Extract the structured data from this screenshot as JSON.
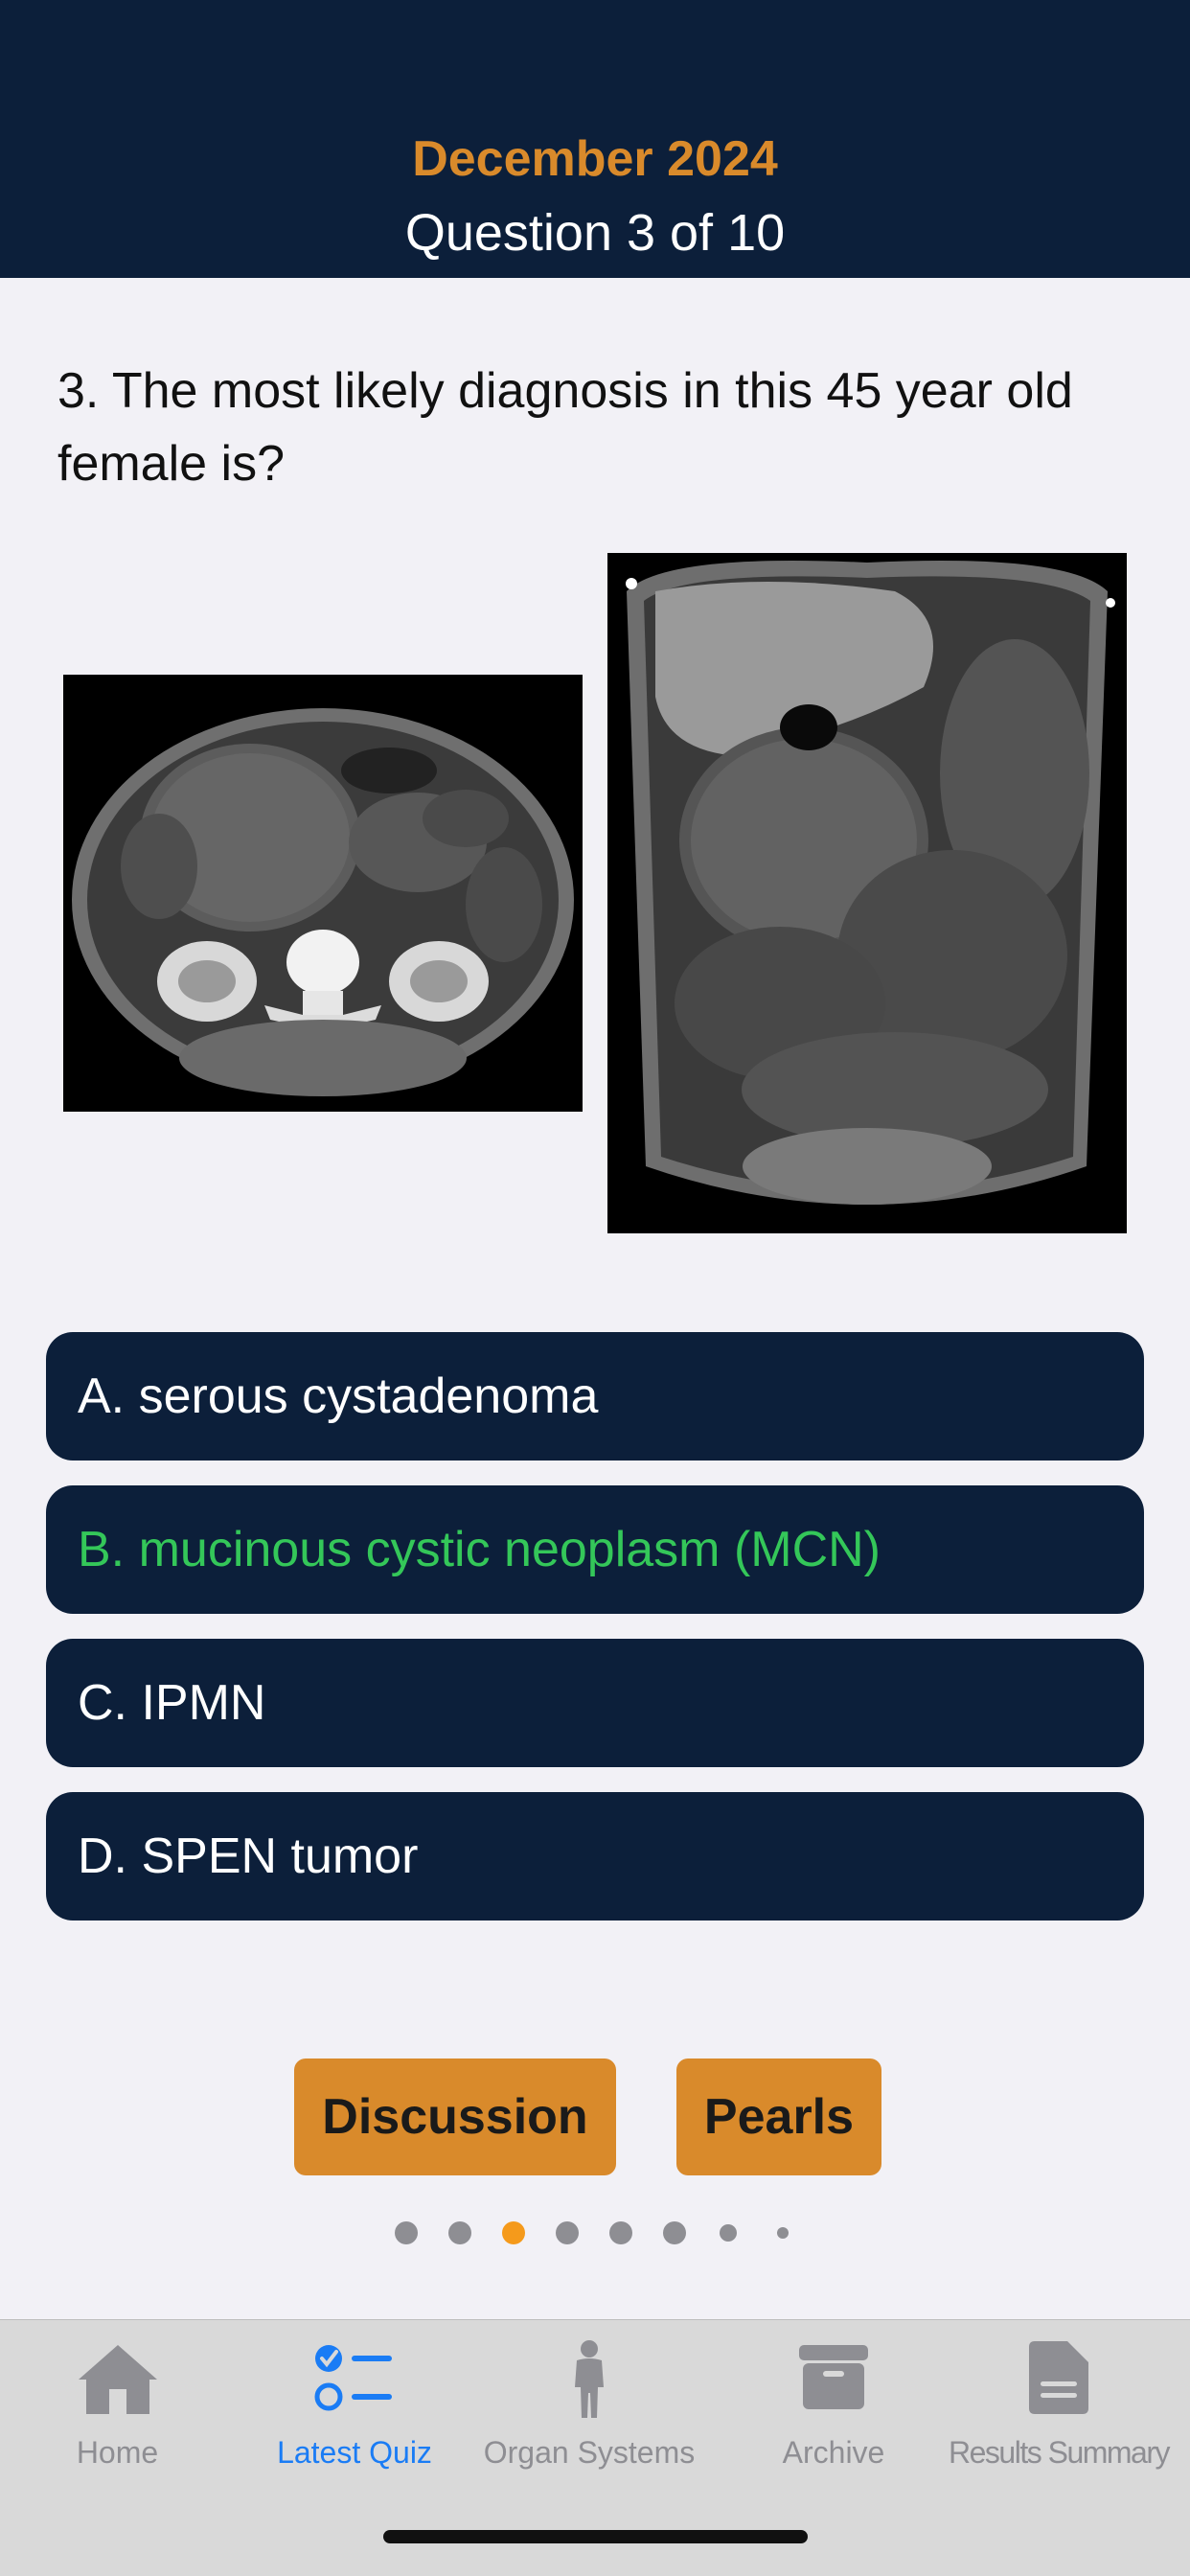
{
  "header": {
    "month": "December 2024",
    "progress": "Question 3 of 10"
  },
  "question": {
    "text": "3. The most likely diagnosis in this 45 year old female is?"
  },
  "options": [
    {
      "label": "A. serous cystadenoma",
      "state": "default"
    },
    {
      "label": "B. mucinous cystic neoplasm (MCN)",
      "state": "correct"
    },
    {
      "label": "C. IPMN",
      "state": "default"
    },
    {
      "label": "D. SPEN tumor",
      "state": "default"
    }
  ],
  "buttons": {
    "discussion": "Discussion",
    "pearls": "Pearls"
  },
  "pager": {
    "count": 8,
    "active_index": 2
  },
  "tabbar": {
    "items": [
      {
        "label": "Home",
        "icon": "house-icon",
        "active": false
      },
      {
        "label": "Latest Quiz",
        "icon": "checklist-icon",
        "active": true
      },
      {
        "label": "Organ Systems",
        "icon": "person-icon",
        "active": false
      },
      {
        "label": "Archive",
        "icon": "archive-box-icon",
        "active": false
      },
      {
        "label": "Results Summary",
        "icon": "document-icon",
        "active": false
      }
    ]
  },
  "colors": {
    "navy": "#0c1f3a",
    "accent_orange": "#d98a2b",
    "correct_green": "#34c759",
    "tab_active_blue": "#1a7cf5"
  }
}
